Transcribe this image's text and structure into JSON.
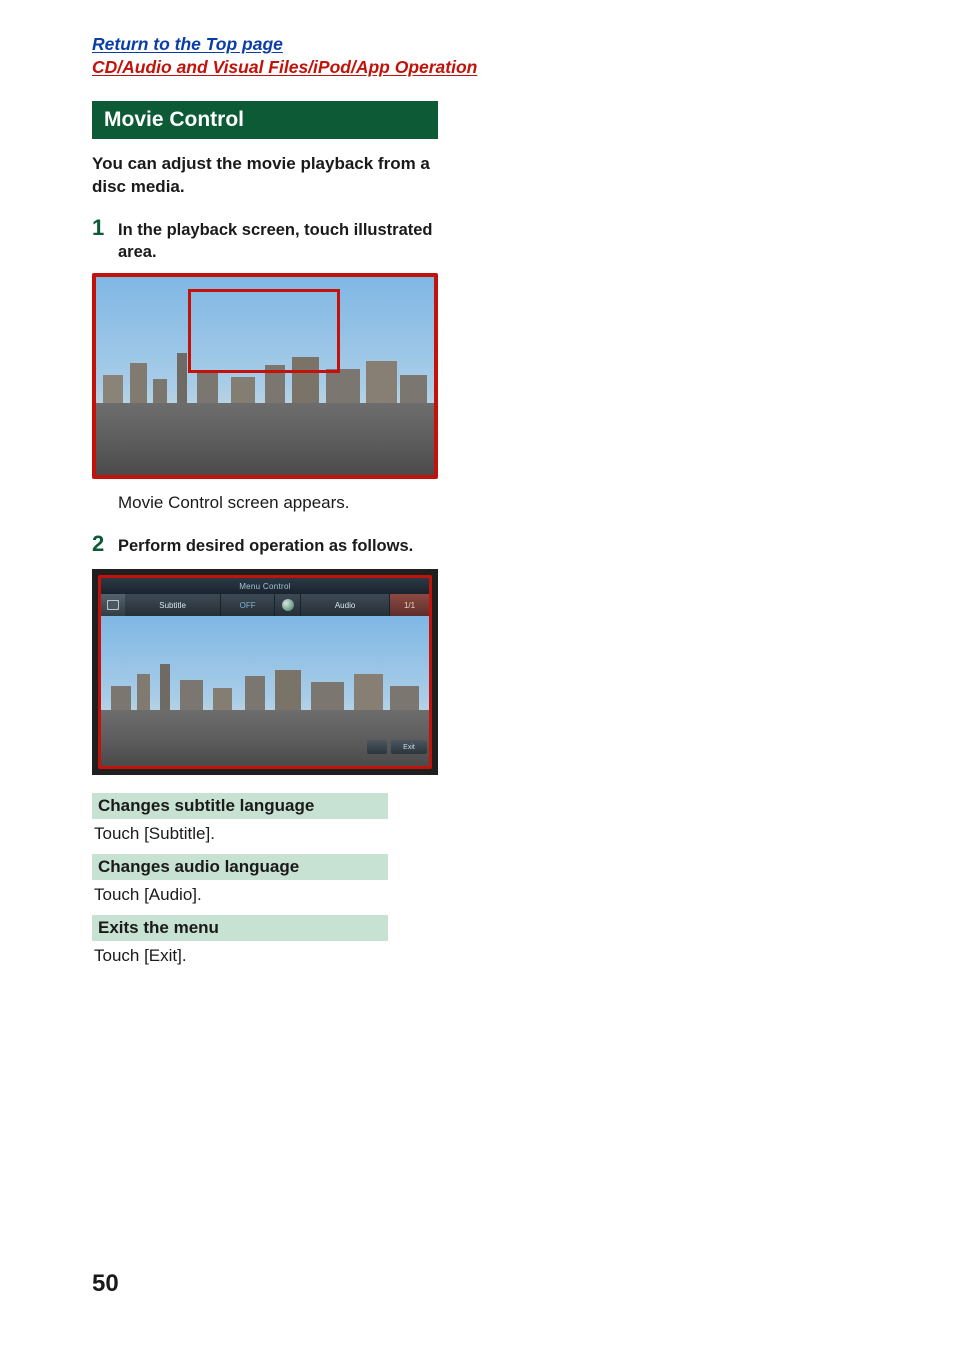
{
  "header": {
    "top_link": "Return to the Top page",
    "section_link": "CD/Audio and Visual Files/iPod/App Operation"
  },
  "title": "Movie Control",
  "intro": "You can adjust the movie playback from a disc media.",
  "steps": [
    {
      "num": "1",
      "text": "In the playback screen, touch illustrated area.",
      "caption": "Movie Control screen appears."
    },
    {
      "num": "2",
      "text": "Perform desired operation as follows."
    }
  ],
  "menu_control": {
    "title": "Menu Control",
    "subtitle_label": "Subtitle",
    "off_label": "OFF",
    "audio_label": "Audio",
    "page_indicator": "1/1",
    "exit_label": "Exit"
  },
  "operations": [
    {
      "head": "Changes subtitle language",
      "body": "Touch [Subtitle]."
    },
    {
      "head": "Changes audio language",
      "body": "Touch [Audio]."
    },
    {
      "head": "Exits the menu",
      "body": "Touch [Exit]."
    }
  ],
  "page_number": "50"
}
